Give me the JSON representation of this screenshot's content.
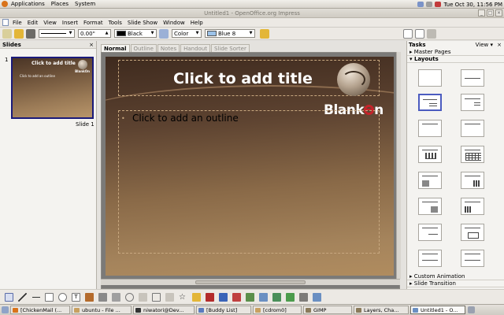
{
  "topbar": {
    "menu": [
      "Applications",
      "Places",
      "System"
    ],
    "clock": "Tue Oct 30, 11:56 PM"
  },
  "window": {
    "title": "Untitled1 - OpenOffice.org Impress"
  },
  "menubar": [
    "File",
    "Edit",
    "View",
    "Insert",
    "Format",
    "Tools",
    "Slide Show",
    "Window",
    "Help"
  ],
  "toolbar": {
    "line_width": "0.00\"",
    "line_color": "Black",
    "area_style": "Color",
    "area_color": "Blue 8"
  },
  "slides_panel": {
    "title": "Slides",
    "slide_number": "1",
    "slide_label": "Slide 1",
    "thumb_title": "Click to add title",
    "thumb_outline": "Click to add an outline",
    "thumb_logo": "BlankOn"
  },
  "view_tabs": [
    "Normal",
    "Outline",
    "Notes",
    "Handout",
    "Slide Sorter"
  ],
  "slide": {
    "title_placeholder": "Click to add title",
    "outline_placeholder": "Click to add an outline",
    "bullet": "•",
    "logo_pre": "Blank",
    "logo_post": "n"
  },
  "tasks_panel": {
    "title": "Tasks",
    "view_label": "View",
    "master_pages": "Master Pages",
    "layouts": "Layouts",
    "custom_animation": "Custom Animation",
    "slide_transition": "Slide Transition"
  },
  "taskbar": {
    "items": [
      "[ChickenMail (...",
      "ubuntu - File ...",
      "niwatori@Dev...",
      "[Buddy List]",
      "[cdrom0]",
      "GIMP",
      "Layers, Cha...",
      "Untitled1 - O..."
    ]
  },
  "colors": {
    "slide_top": "#3e2a1e",
    "slide_bottom": "#b08c5f",
    "selection": "#4b5bbf",
    "ubuntu_orange": "#d9731a"
  }
}
